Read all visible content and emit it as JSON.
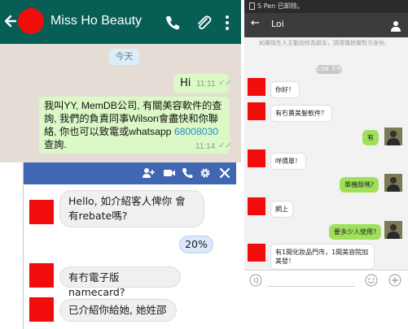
{
  "whatsapp": {
    "contact_name": "Miss Ho Beauty",
    "date_chip": "今天",
    "messages": [
      {
        "text": "Hi",
        "time": "11:11",
        "ticks": "✓✓"
      },
      {
        "text_before": "我叫YY, MemDB公司, 有關美容軟件的查詢, 我們的負責同事Wilson會盡快和你聯絡, 你也可以致電或whatsapp ",
        "phone": "68008030",
        "text_after": " 查詢.",
        "time": "11:14",
        "ticks": "✓✓"
      }
    ]
  },
  "messenger": {
    "messages": [
      {
        "side": "in",
        "text": "Hello, 如介紹客人俾你 會有rebate嗎?"
      },
      {
        "side": "out",
        "text": "20%"
      },
      {
        "side": "in",
        "text": "有冇電子版namecard?"
      },
      {
        "side": "in",
        "text": "已介紹你給她, 她姓邵"
      }
    ]
  },
  "line": {
    "status_text": "S Pen 已卸除。",
    "contact_name": "Loi",
    "notice": "如果陌生人主動加你為朋友，請謹慎核實對方身份。",
    "date_chip": "1:58 下午",
    "messages": [
      {
        "side": "in",
        "text": "你好！"
      },
      {
        "side": "in",
        "text": "有冇賣美髮軟件？"
      },
      {
        "side": "out",
        "text": "有"
      },
      {
        "side": "in",
        "text": "咩價單！"
      },
      {
        "side": "out",
        "text": "單機版嗎?"
      },
      {
        "side": "in",
        "text": "網上"
      },
      {
        "side": "out",
        "text": "要多少人使用?"
      },
      {
        "side": "in",
        "text": "有1間化妝品門市，1間美容院加美發！"
      }
    ]
  },
  "colors": {
    "whatsapp_header": "#075e54",
    "whatsapp_outgoing": "#dcf8c6",
    "messenger_header": "#4267b2",
    "line_outgoing": "#9ee05a",
    "redaction": "#f20d0d"
  }
}
